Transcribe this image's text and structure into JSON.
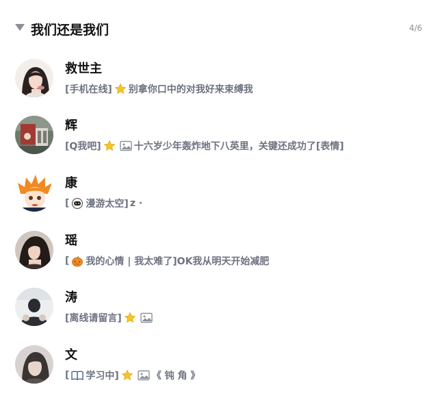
{
  "group": {
    "title": "我们还是我们",
    "count": "4/6"
  },
  "contacts": [
    {
      "name": "救世主",
      "status_open": "[手机在线]",
      "message": "别拿你口中的对我好来束缚我"
    },
    {
      "name": "辉",
      "status_open": "[Q我吧]",
      "message": "十六岁少年轰炸地下八英里，关键还成功了[表情]"
    },
    {
      "name": "康",
      "status_open": "[",
      "status_label": "漫游太空]",
      "message": "z ·"
    },
    {
      "name": "瑶",
      "status_open": "[",
      "status_label": "我的心情 | 我太难了]",
      "message": "OK我从明天开始减肥"
    },
    {
      "name": "涛",
      "status_open": "[离线请留言]"
    },
    {
      "name": "文",
      "status_open": "[",
      "status_label": "学习中]",
      "message": "《 钝 角 》"
    }
  ],
  "icons": {
    "collapse": "caret-down-icon",
    "star": "star-icon",
    "image": "image-icon",
    "astronaut": "astronaut-icon",
    "pumpkin": "pumpkin-icon",
    "book": "book-icon"
  },
  "colors": {
    "title": "#111111",
    "status": "#6d7380",
    "muted": "#8a8f99",
    "star": "#f6c42a"
  }
}
